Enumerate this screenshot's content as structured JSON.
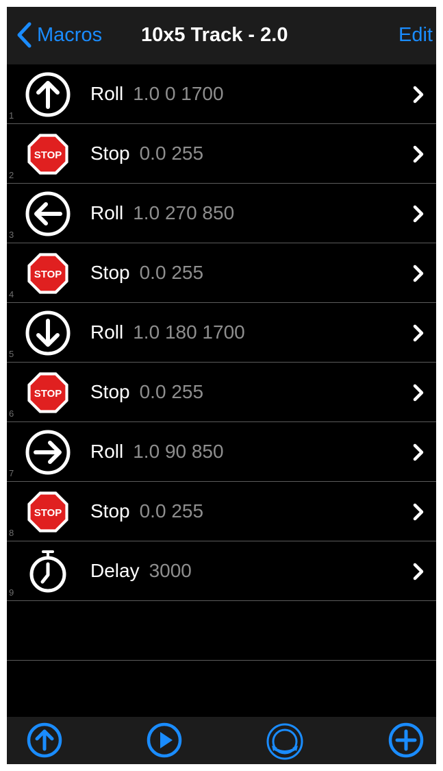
{
  "nav": {
    "back_label": "Macros",
    "title": "10x5 Track - 2.0",
    "edit_label": "Edit"
  },
  "rows": [
    {
      "index": "1",
      "icon": "arrow-up-icon",
      "command": "Roll",
      "params": "1.0 0 1700"
    },
    {
      "index": "2",
      "icon": "stop-sign-icon",
      "command": "Stop",
      "params": "0.0 255"
    },
    {
      "index": "3",
      "icon": "arrow-left-icon",
      "command": "Roll",
      "params": "1.0 270 850"
    },
    {
      "index": "4",
      "icon": "stop-sign-icon",
      "command": "Stop",
      "params": "0.0 255"
    },
    {
      "index": "5",
      "icon": "arrow-down-icon",
      "command": "Roll",
      "params": "1.0 180 1700"
    },
    {
      "index": "6",
      "icon": "stop-sign-icon",
      "command": "Stop",
      "params": "0.0 255"
    },
    {
      "index": "7",
      "icon": "arrow-right-icon",
      "command": "Roll",
      "params": "1.0 90 850"
    },
    {
      "index": "8",
      "icon": "stop-sign-icon",
      "command": "Stop",
      "params": "0.0 255"
    },
    {
      "index": "9",
      "icon": "stopwatch-icon",
      "command": "Delay",
      "params": "3000"
    }
  ],
  "stop_sign_text": "STOP",
  "toolbar": {
    "buttons": [
      "upload-icon",
      "play-icon",
      "device-rotate-icon",
      "add-icon"
    ]
  },
  "colors": {
    "accent": "#1a8cff",
    "background": "#000000",
    "bar": "#1c1c1c",
    "stop_red": "#e02020",
    "param_gray": "#8e8e8e"
  }
}
